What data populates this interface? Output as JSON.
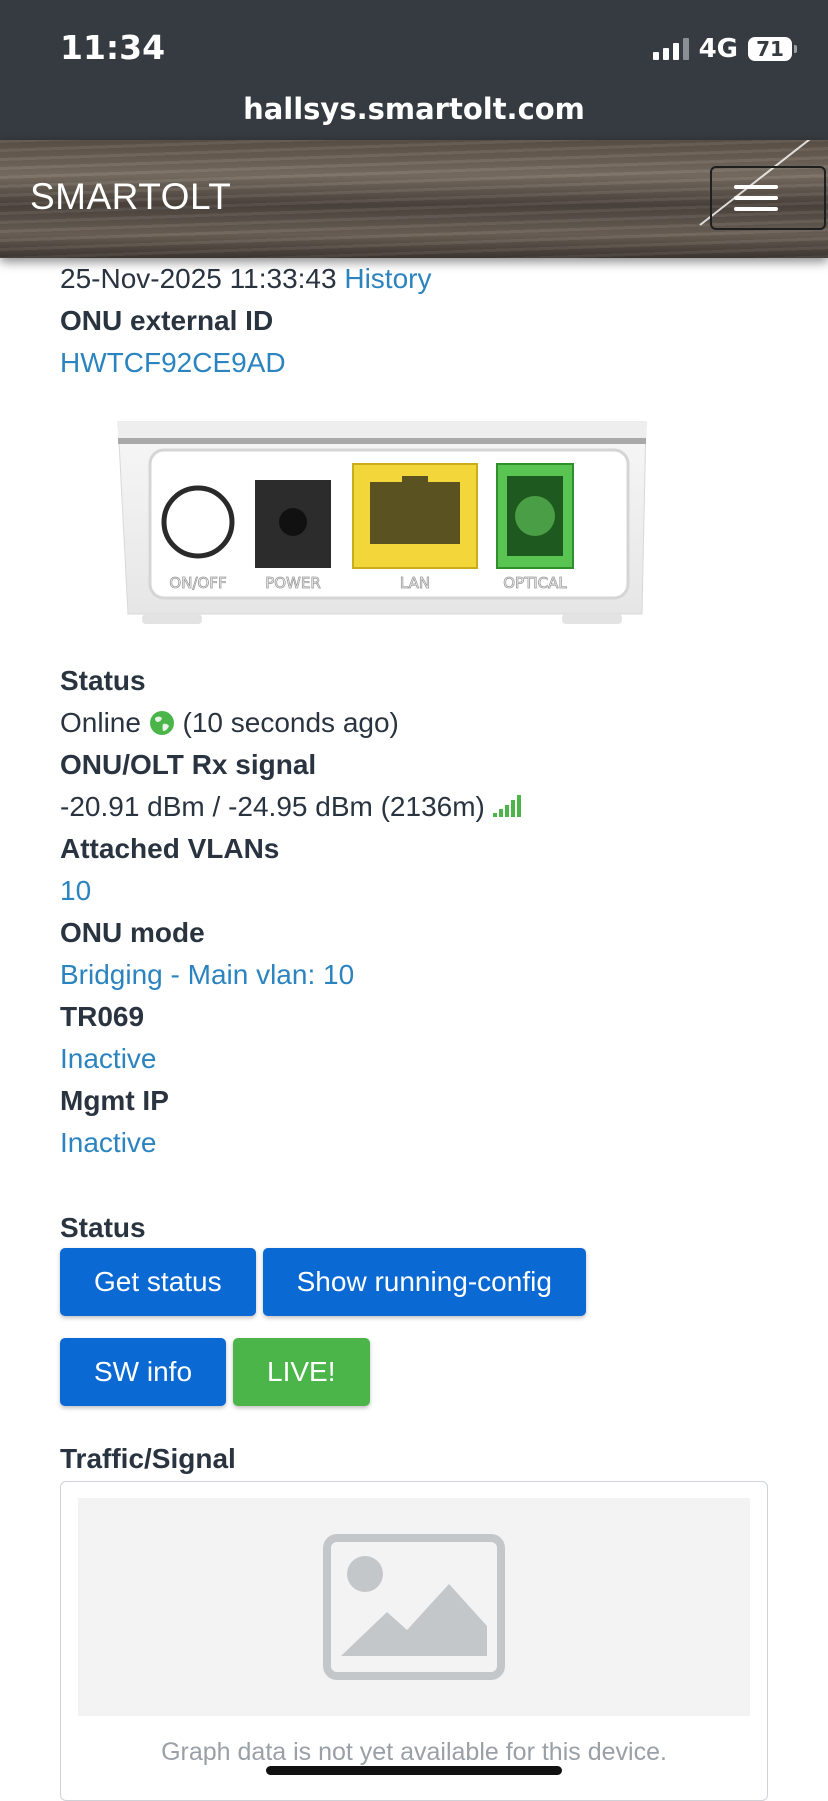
{
  "status_bar": {
    "time": "11:34",
    "network": "4G",
    "battery": "71"
  },
  "browser": {
    "url": "hallsys.smartolt.com"
  },
  "header": {
    "brand": "SMARTOLT"
  },
  "onu": {
    "timestamp": "25-Nov-2025 11:33:43",
    "history_link": "History",
    "external_id_label": "ONU external ID",
    "external_id": "HWTCF92CE9AD",
    "device_ports": [
      "ON/OFF",
      "POWER",
      "LAN",
      "OPTICAL"
    ],
    "status_label": "Status",
    "status_value": "Online",
    "status_ago": "(10 seconds ago)",
    "rx_label": "ONU/OLT Rx signal",
    "rx_value": "-20.91 dBm / -24.95 dBm (2136m)",
    "vlans_label": "Attached VLANs",
    "vlans_value": "10",
    "mode_label": "ONU mode",
    "mode_value": "Bridging - Main vlan: 10",
    "tr069_label": "TR069",
    "tr069_value": "Inactive",
    "mgmt_label": "Mgmt IP",
    "mgmt_value": "Inactive"
  },
  "actions": {
    "section_label": "Status",
    "get_status": "Get status",
    "show_running_config": "Show running-config",
    "sw_info": "SW info",
    "live": "LIVE!"
  },
  "traffic": {
    "label": "Traffic/Signal",
    "note": "Graph data is not yet available for this device."
  },
  "colors": {
    "link": "#2b84bf",
    "button_blue": "#0b69d4",
    "button_green": "#4cb54a",
    "online": "#4cb54a"
  }
}
